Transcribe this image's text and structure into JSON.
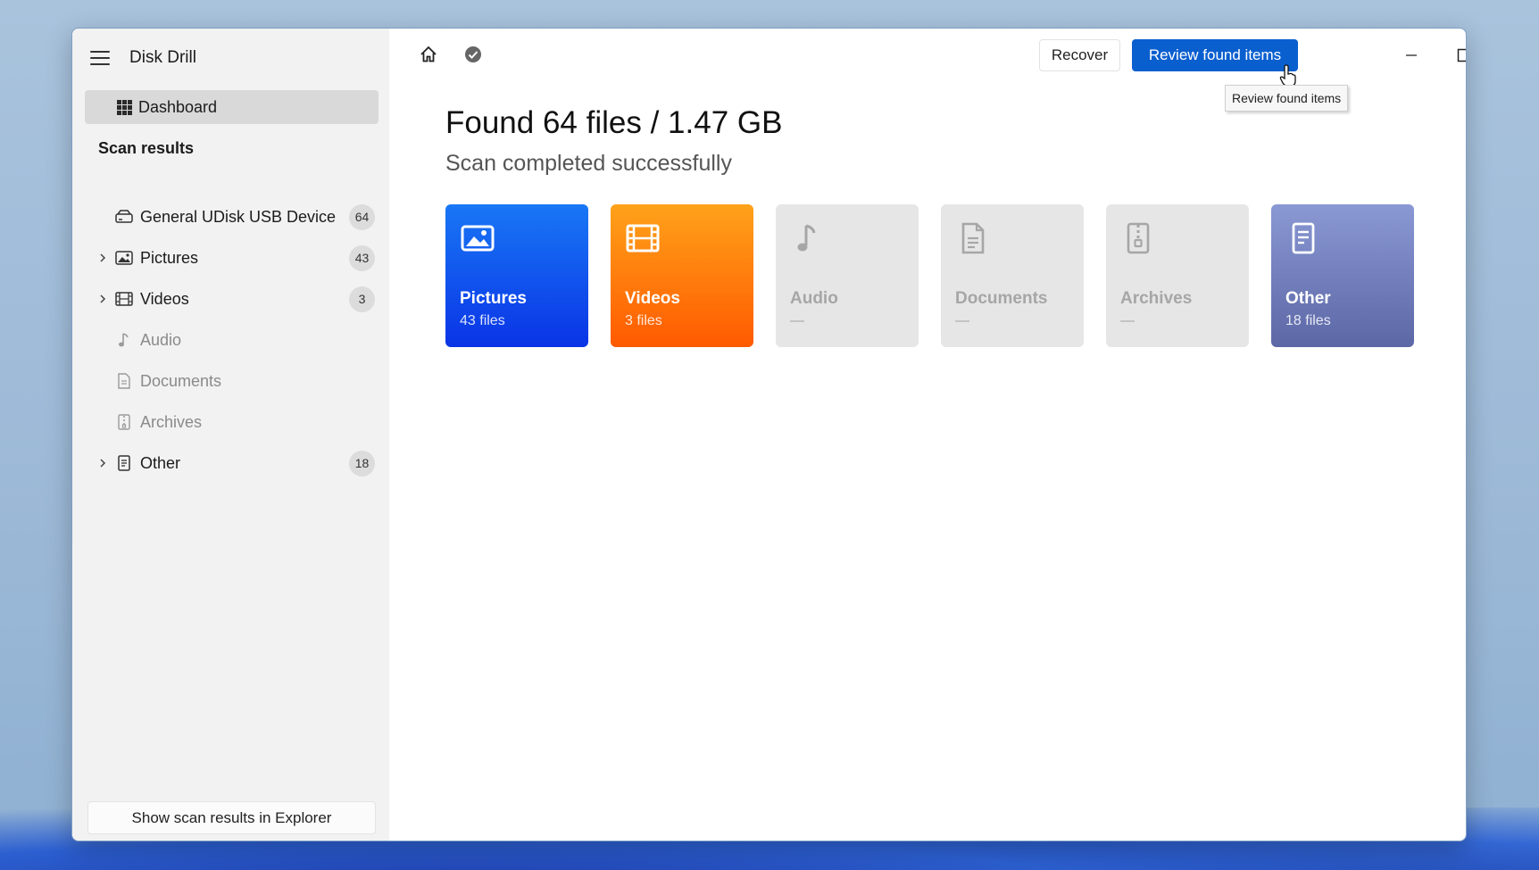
{
  "app": {
    "title": "Disk Drill"
  },
  "sidebar": {
    "dashboard_label": "Dashboard",
    "section_title": "Scan results",
    "items": [
      {
        "label": "General UDisk USB Device",
        "count": "64",
        "icon": "drive-icon",
        "expandable": false,
        "disabled": false
      },
      {
        "label": "Pictures",
        "count": "43",
        "icon": "picture-icon",
        "expandable": true,
        "disabled": false
      },
      {
        "label": "Videos",
        "count": "3",
        "icon": "film-icon",
        "expandable": true,
        "disabled": false
      },
      {
        "label": "Audio",
        "count": "",
        "icon": "music-note-icon",
        "expandable": false,
        "disabled": true
      },
      {
        "label": "Documents",
        "count": "",
        "icon": "document-icon",
        "expandable": false,
        "disabled": true
      },
      {
        "label": "Archives",
        "count": "",
        "icon": "archive-icon",
        "expandable": false,
        "disabled": true
      },
      {
        "label": "Other",
        "count": "18",
        "icon": "other-file-icon",
        "expandable": true,
        "disabled": false
      }
    ],
    "explorer_button": "Show scan results in Explorer"
  },
  "toolbar": {
    "recover_label": "Recover",
    "review_label": "Review found items",
    "tooltip": "Review found items"
  },
  "main": {
    "headline": "Found 64 files / 1.47 GB",
    "subline": "Scan completed successfully",
    "cards": [
      {
        "title": "Pictures",
        "subtitle": "43 files",
        "icon": "picture-icon",
        "color": "#1977f5"
      },
      {
        "title": "Videos",
        "subtitle": "3 files",
        "icon": "film-icon",
        "color": "#ff7a0a"
      },
      {
        "title": "Audio",
        "subtitle": "—",
        "icon": "music-note-icon",
        "color": "#e6e6e6"
      },
      {
        "title": "Documents",
        "subtitle": "—",
        "icon": "document-icon",
        "color": "#e6e6e6"
      },
      {
        "title": "Archives",
        "subtitle": "—",
        "icon": "archive-icon",
        "color": "#e6e6e6"
      },
      {
        "title": "Other",
        "subtitle": "18 files",
        "icon": "other-file-icon",
        "color": "#7583c4"
      }
    ]
  }
}
